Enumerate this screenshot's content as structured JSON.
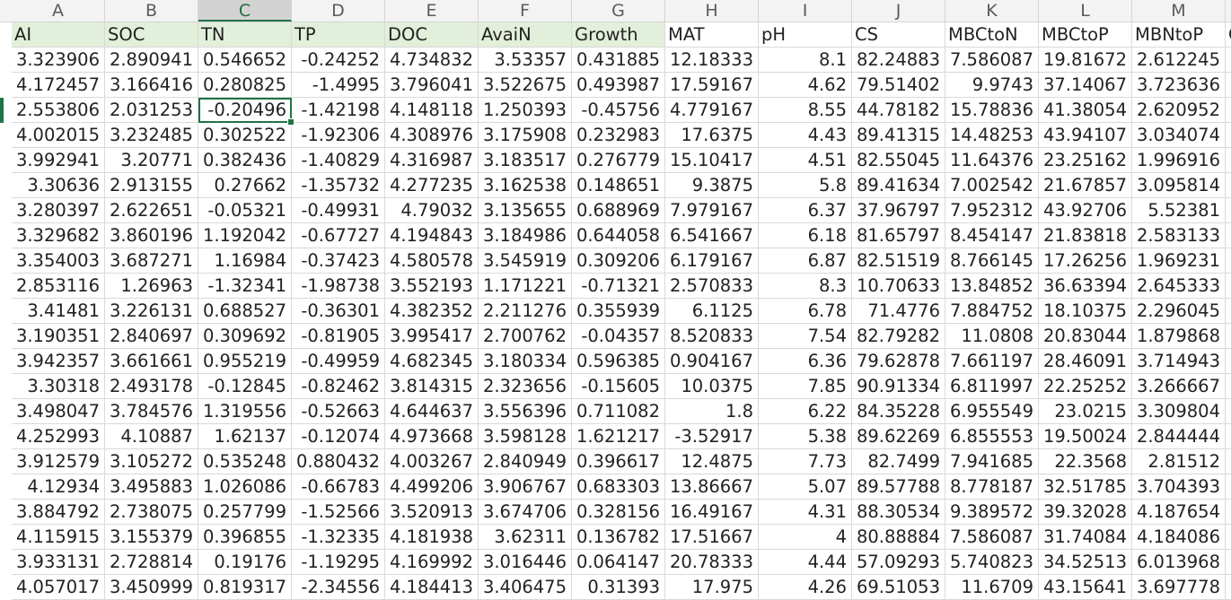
{
  "columns": [
    "A",
    "B",
    "C",
    "D",
    "E",
    "F",
    "G",
    "H",
    "I",
    "J",
    "K",
    "L",
    "M"
  ],
  "selected_column": "C",
  "headers": [
    "AI",
    "SOC",
    "TN",
    "TP",
    "DOC",
    "AvaiN",
    "Growth",
    "MAT",
    "pH",
    "CS",
    "MBCtoN",
    "MBCtoP",
    "MBNtoP",
    "C"
  ],
  "row_labels": [
    "",
    "",
    "",
    "",
    "",
    "",
    "",
    "",
    "",
    "",
    "",
    "",
    "",
    "",
    "",
    "",
    "",
    "",
    "",
    "",
    "",
    ""
  ],
  "rows": [
    [
      "3.323906",
      "2.890941",
      "0.546652",
      "-0.24252",
      "4.734832",
      "3.53357",
      "0.431885",
      "12.18333",
      "8.1",
      "82.24883",
      "7.586087",
      "19.81672",
      "2.612245"
    ],
    [
      "4.172457",
      "3.166416",
      "0.280825",
      "-1.4995",
      "3.796041",
      "3.522675",
      "0.493987",
      "17.59167",
      "4.62",
      "79.51402",
      "9.9743",
      "37.14067",
      "3.723636"
    ],
    [
      "2.553806",
      "2.031253",
      "-0.20496",
      "-1.42198",
      "4.148118",
      "1.250393",
      "-0.45756",
      "4.779167",
      "8.55",
      "44.78182",
      "15.78836",
      "41.38054",
      "2.620952"
    ],
    [
      "4.002015",
      "3.232485",
      "0.302522",
      "-1.92306",
      "4.308976",
      "3.175908",
      "0.232983",
      "17.6375",
      "4.43",
      "89.41315",
      "14.48253",
      "43.94107",
      "3.034074"
    ],
    [
      "3.992941",
      "3.20771",
      "0.382436",
      "-1.40829",
      "4.316987",
      "3.183517",
      "0.276779",
      "15.10417",
      "4.51",
      "82.55045",
      "11.64376",
      "23.25162",
      "1.996916"
    ],
    [
      "3.30636",
      "2.913155",
      "0.27662",
      "-1.35732",
      "4.277235",
      "3.162538",
      "0.148651",
      "9.3875",
      "5.8",
      "89.41634",
      "7.002542",
      "21.67857",
      "3.095814"
    ],
    [
      "3.280397",
      "2.622651",
      "-0.05321",
      "-0.49931",
      "4.79032",
      "3.135655",
      "0.688969",
      "7.979167",
      "6.37",
      "37.96797",
      "7.952312",
      "43.92706",
      "5.52381"
    ],
    [
      "3.329682",
      "3.860196",
      "1.192042",
      "-0.67727",
      "4.194843",
      "3.184986",
      "0.644058",
      "6.541667",
      "6.18",
      "81.65797",
      "8.454147",
      "21.83818",
      "2.583133"
    ],
    [
      "3.354003",
      "3.687271",
      "1.16984",
      "-0.37423",
      "4.580578",
      "3.545919",
      "0.309206",
      "6.179167",
      "6.87",
      "82.51519",
      "8.766145",
      "17.26256",
      "1.969231"
    ],
    [
      "2.853116",
      "1.26963",
      "-1.32341",
      "-1.98738",
      "3.552193",
      "1.171221",
      "-0.71321",
      "2.570833",
      "8.3",
      "10.70633",
      "13.84852",
      "36.63394",
      "2.645333"
    ],
    [
      "3.41481",
      "3.226131",
      "0.688527",
      "-0.36301",
      "4.382352",
      "2.211276",
      "0.355939",
      "6.1125",
      "6.78",
      "71.4776",
      "7.884752",
      "18.10375",
      "2.296045"
    ],
    [
      "3.190351",
      "2.840697",
      "0.309692",
      "-0.81905",
      "3.995417",
      "2.700762",
      "-0.04357",
      "8.520833",
      "7.54",
      "82.79282",
      "11.0808",
      "20.83044",
      "1.879868"
    ],
    [
      "3.942357",
      "3.661661",
      "0.955219",
      "-0.49959",
      "4.682345",
      "3.180334",
      "0.596385",
      "0.904167",
      "6.36",
      "79.62878",
      "7.661197",
      "28.46091",
      "3.714943"
    ],
    [
      "3.30318",
      "2.493178",
      "-0.12845",
      "-0.82462",
      "3.814315",
      "2.323656",
      "-0.15605",
      "10.0375",
      "7.85",
      "90.91334",
      "6.811997",
      "22.25252",
      "3.266667"
    ],
    [
      "3.498047",
      "3.784576",
      "1.319556",
      "-0.52663",
      "4.644637",
      "3.556396",
      "0.711082",
      "1.8",
      "6.22",
      "84.35228",
      "6.955549",
      "23.0215",
      "3.309804"
    ],
    [
      "4.252993",
      "4.10887",
      "1.62137",
      "-0.12074",
      "4.973668",
      "3.598128",
      "1.621217",
      "-3.52917",
      "5.38",
      "89.62269",
      "6.855553",
      "19.50024",
      "2.844444"
    ],
    [
      "3.912579",
      "3.105272",
      "0.535248",
      "0.880432",
      "4.003267",
      "2.840949",
      "0.396617",
      "12.4875",
      "7.73",
      "82.7499",
      "7.941685",
      "22.3568",
      "2.81512"
    ],
    [
      "4.12934",
      "3.495883",
      "1.026086",
      "-0.66783",
      "4.499206",
      "3.906767",
      "0.683303",
      "13.86667",
      "5.07",
      "89.57788",
      "8.778187",
      "32.51785",
      "3.704393"
    ],
    [
      "3.884792",
      "2.738075",
      "0.257799",
      "-1.52566",
      "3.520913",
      "3.674706",
      "0.328156",
      "16.49167",
      "4.31",
      "88.30534",
      "9.389572",
      "39.32028",
      "4.187654"
    ],
    [
      "4.115915",
      "3.155379",
      "0.396855",
      "-1.32335",
      "4.181938",
      "3.62311",
      "0.136782",
      "17.51667",
      "4",
      "80.88884",
      "7.586087",
      "31.74084",
      "4.184086"
    ],
    [
      "3.933131",
      "2.728814",
      "0.19176",
      "-1.19295",
      "4.169992",
      "3.016446",
      "0.064147",
      "20.78333",
      "4.44",
      "57.09293",
      "5.740823",
      "34.52513",
      "6.013968"
    ],
    [
      "4.057017",
      "3.450999",
      "0.819317",
      "-2.34556",
      "4.184413",
      "3.406475",
      "0.31393",
      "17.975",
      "4.26",
      "69.51053",
      "11.6709",
      "43.15641",
      "3.697778"
    ]
  ],
  "active_cell": {
    "row": 3,
    "col": "C",
    "value": "-0.20496"
  },
  "colors": {
    "header_fill": "#e2efda",
    "selection": "#217346"
  }
}
